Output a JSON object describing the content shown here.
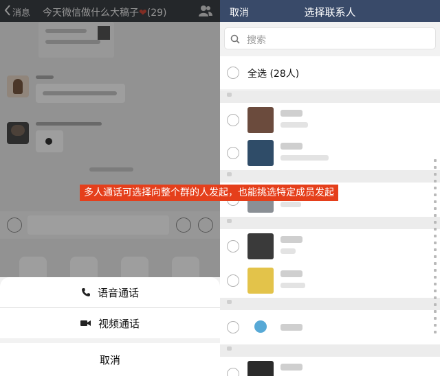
{
  "left": {
    "nav": {
      "back_label": "消息",
      "title": "今天微信做什么大稿子",
      "heart": "❤",
      "count": "(29)"
    }
  },
  "sheet": {
    "voice_label": "语音通话",
    "video_label": "视频通话",
    "cancel_label": "取消"
  },
  "right": {
    "nav": {
      "cancel_label": "取消",
      "title": "选择联系人"
    },
    "search": {
      "placeholder": "搜索"
    },
    "select_all_label": "全选 (28人)"
  },
  "caption": "多人通话可选择向整个群的人发起，也能挑选特定成员发起",
  "colors": {
    "left_nav_bg": "#3b3f45",
    "right_nav_bg": "#394a69",
    "caption_bg": "#e53f1b",
    "heart": "#d04a3a"
  }
}
